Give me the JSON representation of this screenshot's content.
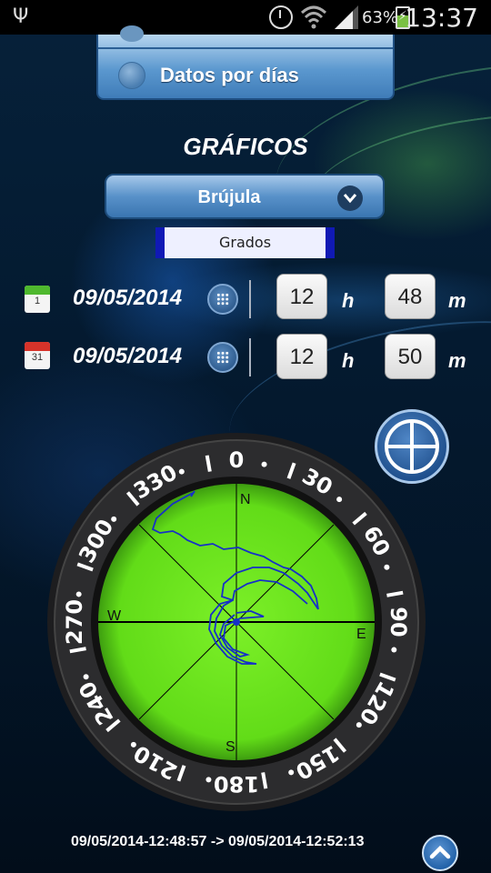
{
  "status_bar": {
    "battery_percent": "63%",
    "time": "13:37",
    "icons": [
      "usb-icon",
      "alarm-icon",
      "wifi-icon",
      "signal-icon",
      "battery-charging-icon"
    ]
  },
  "options": {
    "datos_label": "Datos por días"
  },
  "graficos_title": "GRÁFICOS",
  "chart_select": {
    "selected": "Brújula"
  },
  "unit_tab": "Grados",
  "start": {
    "date": "09/05/2014",
    "hour": "12",
    "minute": "48",
    "h_label": "h",
    "m_label": "m",
    "calendar_day": "1"
  },
  "end": {
    "date": "09/05/2014",
    "hour": "12",
    "minute": "50",
    "h_label": "h",
    "m_label": "m",
    "calendar_day": "31"
  },
  "compass": {
    "cardinals": {
      "n": "N",
      "e": "E",
      "s": "S",
      "w": "W"
    },
    "bezel_labels": [
      "0",
      "30",
      "60",
      "90",
      "120",
      "150",
      "180",
      "210",
      "240",
      "270",
      "300",
      "330"
    ],
    "colors": {
      "dial": "#6fe81f",
      "trace": "#1630c8",
      "bezel": "#2a2a2c"
    }
  },
  "footer": {
    "range": "09/05/2014-12:48:57 -> 09/05/2014-12:52:13"
  },
  "colors": {
    "accent": "#3f7cb8",
    "tab_border": "#1019b5"
  }
}
